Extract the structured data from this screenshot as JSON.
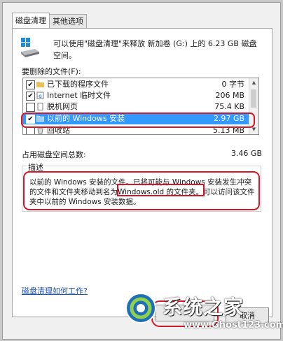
{
  "tabs": [
    "磁盘清理",
    "其他选项"
  ],
  "intro_text": "可以使用\"磁盘清理\"来释放 新加卷 (G:) 上的 6.23 GB 磁盘空间。",
  "files_label": "要删除的文件(F):",
  "files": [
    {
      "checked": true,
      "icon": "folder-icon",
      "name": "已下载的程序文件",
      "size": "0 字节"
    },
    {
      "checked": true,
      "icon": "internet-icon",
      "name": "Internet 临时文件",
      "size": "206 MB"
    },
    {
      "checked": false,
      "icon": "page-icon",
      "name": "脱机网页",
      "size": "75.4 KB"
    },
    {
      "checked": true,
      "icon": "windows-folder-icon",
      "name": "以前的 Windows 安装",
      "size": "2.97 GB",
      "selected": true
    },
    {
      "checked": false,
      "icon": "recycle-bin-icon",
      "name": "回收站",
      "size": "5.13 MB"
    }
  ],
  "total_label": "占用磁盘空间总数:",
  "total_value": "3.46 GB",
  "description_title": "描述",
  "description": {
    "part1": "以前的 Windows 安装的文件。已将可能与 Windows 安装发生冲突的文件和文件夹移动到名为",
    "highlight": "Windows.old 的文件夹",
    "part2": "。可以访问该文件夹中以前的 Windows 安装数据。"
  },
  "help_link": "磁盘清理如何工作?",
  "cancel_label": "取消",
  "watermark": {
    "title": "系统之家",
    "url": "www.Ghost123.com"
  },
  "colors": {
    "selection": "#3399ff",
    "annotation": "#d0182a",
    "link": "#1e54b5"
  }
}
